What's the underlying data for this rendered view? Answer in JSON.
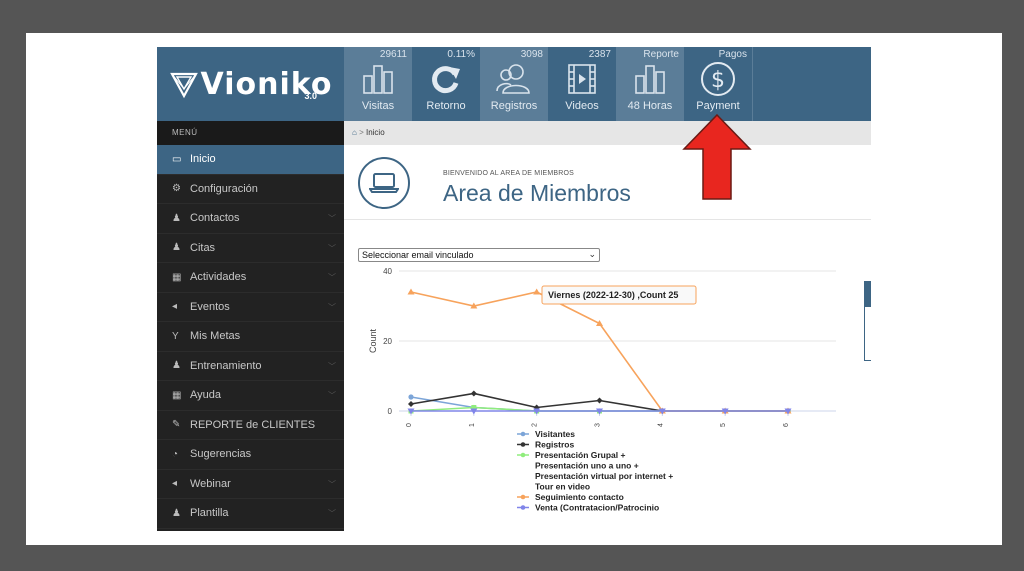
{
  "brand": {
    "name": "Vioniko",
    "version": "3.0"
  },
  "tiles": [
    {
      "count": "29611",
      "label": "Visitas",
      "icon": "bar-chart-icon"
    },
    {
      "count": "0.11%",
      "label": "Retorno",
      "icon": "refresh-icon"
    },
    {
      "count": "3098",
      "label": "Registros",
      "icon": "users-icon"
    },
    {
      "count": "2387",
      "label": "Videos",
      "icon": "film-icon"
    },
    {
      "count": "Reporte",
      "label": "48 Horas",
      "icon": "bar-chart-icon"
    },
    {
      "count": "Pagos",
      "label": "Payment",
      "icon": "dollar-icon"
    }
  ],
  "sidebar": {
    "header": "MENÚ",
    "items": [
      {
        "label": "Inicio",
        "icon": "laptop-icon",
        "active": true,
        "chevron": false
      },
      {
        "label": "Configuración",
        "icon": "gears-icon",
        "active": false,
        "chevron": false
      },
      {
        "label": "Contactos",
        "icon": "user-icon",
        "active": false,
        "chevron": true
      },
      {
        "label": "Citas",
        "icon": "user-icon",
        "active": false,
        "chevron": true
      },
      {
        "label": "Actividades",
        "icon": "calendar-icon",
        "active": false,
        "chevron": true
      },
      {
        "label": "Eventos",
        "icon": "bullhorn-icon",
        "active": false,
        "chevron": true
      },
      {
        "label": "Mis Metas",
        "icon": "glass-icon",
        "active": false,
        "chevron": false
      },
      {
        "label": "Entrenamiento",
        "icon": "user-icon",
        "active": false,
        "chevron": true
      },
      {
        "label": "Ayuda",
        "icon": "calendar-icon",
        "active": false,
        "chevron": true
      },
      {
        "label": "REPORTE de CLIENTES",
        "icon": "wrench-icon",
        "active": false,
        "chevron": false
      },
      {
        "label": "Sugerencias",
        "icon": "comments-icon",
        "active": false,
        "chevron": false
      },
      {
        "label": "Webinar",
        "icon": "bullhorn-icon",
        "active": false,
        "chevron": true
      },
      {
        "label": "Plantilla",
        "icon": "group-icon",
        "active": false,
        "chevron": true
      }
    ]
  },
  "breadcrumb": {
    "label": "Inicio"
  },
  "welcome": {
    "subtitle": "BIENVENIDO AL AREA DE MIEMBROS",
    "title": "Area de Miembros"
  },
  "email_select": {
    "value": "Seleccionar email vinculado"
  },
  "tooltip": {
    "text": "Viernes (2022-12-30) ,Count 25"
  },
  "colors": {
    "header": "#3d6584",
    "accent": "#e8261f",
    "sidebar": "#222222"
  },
  "chart_data": {
    "type": "line",
    "ylabel": "Count",
    "ylim": [
      0,
      40
    ],
    "yticks": [
      0,
      20,
      40
    ],
    "x": [
      0,
      1,
      2,
      3,
      4,
      5,
      6
    ],
    "series": [
      {
        "name": "Visitantes",
        "color": "#7ca5d8",
        "marker": "circle",
        "values": [
          4,
          1,
          0,
          0,
          0,
          0,
          0
        ]
      },
      {
        "name": "Registros",
        "color": "#333333",
        "marker": "diamond",
        "values": [
          2,
          5,
          1,
          3,
          0,
          0,
          0
        ]
      },
      {
        "name": "Presentación Grupal + Presentación uno a uno + Presentación virtual por internet + Tour en video",
        "color": "#90ed7d",
        "marker": "square",
        "values": [
          0,
          1,
          0,
          0,
          0,
          0,
          0
        ]
      },
      {
        "name": "Seguimiento contacto",
        "color": "#f7a35c",
        "marker": "triangle",
        "values": [
          34,
          30,
          34,
          25,
          0,
          0,
          0
        ]
      },
      {
        "name": "Venta (Contratacion/Patrocinio",
        "color": "#8085e9",
        "marker": "triangle-down",
        "values": [
          0,
          0,
          0,
          0,
          0,
          0,
          0
        ]
      }
    ],
    "legend_position": "bottom"
  }
}
